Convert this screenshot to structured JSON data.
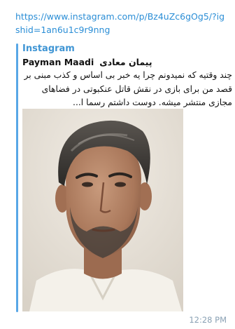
{
  "message": {
    "link_url": "https://www.instagram.com/p/Bz4uZc6gOg5/?igshid=1an6u1c9r9nng",
    "time": "12:28 PM"
  },
  "preview": {
    "site_name": "Instagram",
    "title_en": "Payman Maadi",
    "title_fa": "پیمان معادی",
    "description": "چند وقتیه که نمیدونم چرا یه خبر بی اساس و کذب مبنی بر قصد من برای بازی در نقش قاتل عنکبوتی در فضاهای مجازی منتشر میشه. دوست داشتم رسما ا...",
    "image_subject": "portrait-photo"
  },
  "colors": {
    "link": "#2b8ed6",
    "accent_bar": "#58a7e6",
    "site_name": "#3f95d4",
    "time": "#8aa1b4"
  }
}
